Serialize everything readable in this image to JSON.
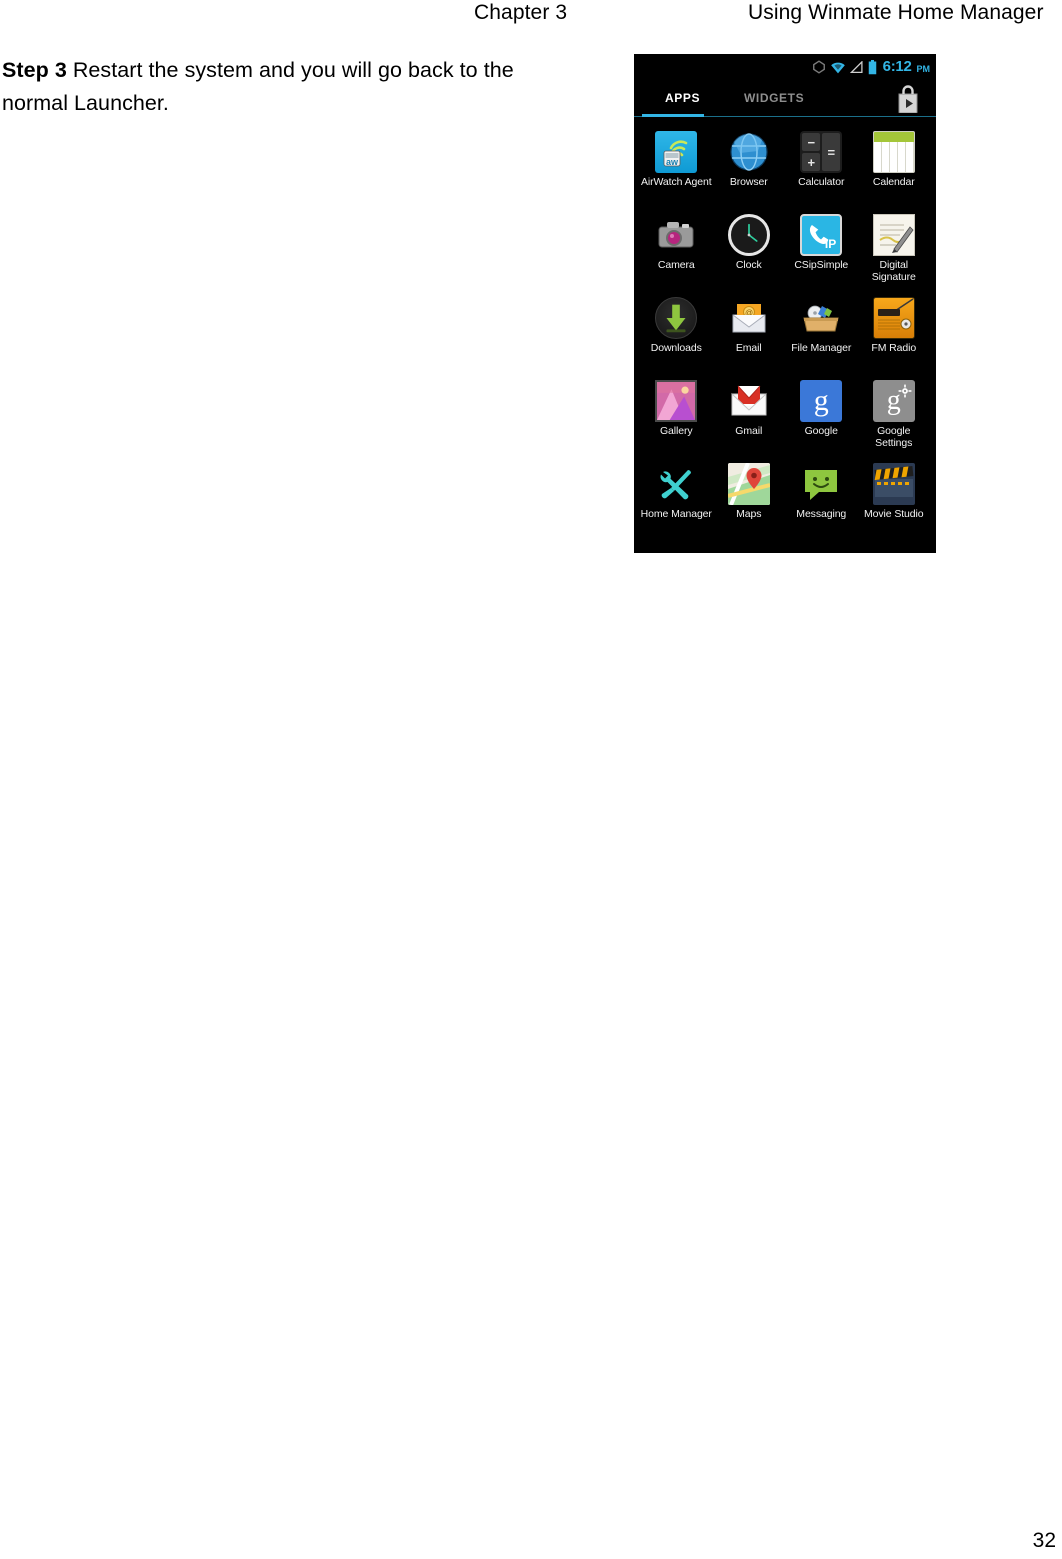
{
  "header": {
    "chapter": "Chapter 3",
    "title": "Using Winmate Home Manager"
  },
  "body": {
    "step_label": "Step 3",
    "step_text": " Restart the system and you will go back to the normal Launcher."
  },
  "footer": {
    "page_number": "32"
  },
  "screenshot": {
    "status_bar": {
      "time": "6:12",
      "ampm": "PM",
      "time_color": "#33b5e5",
      "icons": [
        "sync-icon",
        "wifi-icon",
        "signal-icon",
        "battery-icon"
      ]
    },
    "tabs": [
      {
        "label": "APPS",
        "active": true
      },
      {
        "label": "WIDGETS",
        "active": false
      }
    ],
    "accent_color": "#33b5e5",
    "play_store_label": "play-store-icon",
    "apps": [
      {
        "label": "AirWatch Agent",
        "icon": "airwatch-agent-icon"
      },
      {
        "label": "Browser",
        "icon": "browser-icon"
      },
      {
        "label": "Calculator",
        "icon": "calculator-icon"
      },
      {
        "label": "Calendar",
        "icon": "calendar-icon"
      },
      {
        "label": "Camera",
        "icon": "camera-icon"
      },
      {
        "label": "Clock",
        "icon": "clock-icon"
      },
      {
        "label": "CSipSimple",
        "icon": "csipsimple-icon"
      },
      {
        "label": "Digital Signature",
        "icon": "digital-signature-icon"
      },
      {
        "label": "Downloads",
        "icon": "downloads-icon"
      },
      {
        "label": "Email",
        "icon": "email-icon"
      },
      {
        "label": "File Manager",
        "icon": "file-manager-icon"
      },
      {
        "label": "FM Radio",
        "icon": "fm-radio-icon"
      },
      {
        "label": "Gallery",
        "icon": "gallery-icon"
      },
      {
        "label": "Gmail",
        "icon": "gmail-icon"
      },
      {
        "label": "Google",
        "icon": "google-icon"
      },
      {
        "label": "Google Settings",
        "icon": "google-settings-icon"
      },
      {
        "label": "Home Manager",
        "icon": "home-manager-icon"
      },
      {
        "label": "Maps",
        "icon": "maps-icon"
      },
      {
        "label": "Messaging",
        "icon": "messaging-icon"
      },
      {
        "label": "Movie Studio",
        "icon": "movie-studio-icon"
      }
    ],
    "calculator_keys": [
      "−",
      "=",
      "+"
    ],
    "csip_text": "IP",
    "google_glyph": "g"
  }
}
